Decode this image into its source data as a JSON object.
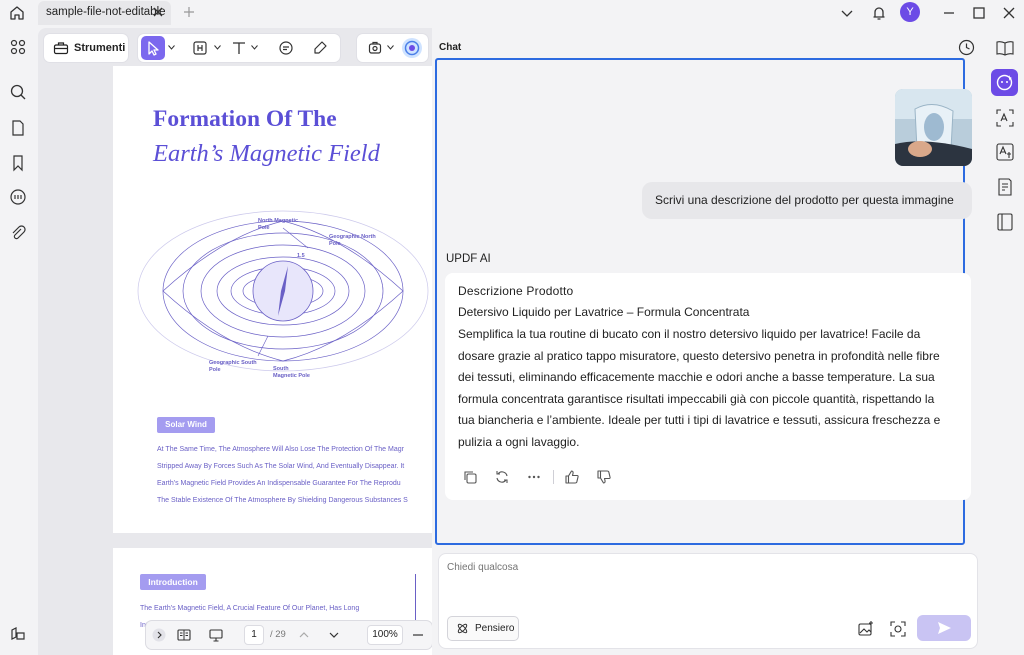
{
  "titlebar": {
    "tab_title": "sample-file-not-editable",
    "avatar_initial": "Y"
  },
  "toolbar": {
    "strumenti_label": "Strumenti"
  },
  "document": {
    "title_line1": "Formation Of The",
    "title_line2": "Earth’s Magnetic Field",
    "diagram_labels": {
      "north_magnetic_pole": "North Magnetic Pole",
      "geographic_north_pole": "Geographic North Pole",
      "angle": "1.5",
      "geographic_south_pole": "Geographic South Pole",
      "south_magnetic_pole": "South Magnetic Pole"
    },
    "solar_wind_tag": "Solar Wind",
    "body_lines": [
      "At The Same Time, The Atmosphere Will Also Lose The Protection Of The Magr",
      "Stripped Away By Forces Such As The Solar Wind, And Eventually Disappear. It",
      "Earth's Magnetic Field Provides An Indispensable Guarantee For The Reprodu",
      "The Stable Existence Of The Atmosphere By Shielding Dangerous Substances S"
    ],
    "intro_tag": "Introduction",
    "intro_lines": [
      "The Earth's Magnetic Field, A Crucial Feature Of Our Planet, Has Long",
      "Int"
    ]
  },
  "pager": {
    "current_page": "1",
    "total_pages": "/ 29",
    "zoom": "100%"
  },
  "chat": {
    "header": "Chat",
    "user_message": "Scrivi una descrizione del prodotto per questa immagine",
    "ai_name": "UPDF AI",
    "response_title": "Descrizione Prodotto",
    "response_subtitle": "Detersivo Liquido per Lavatrice – Formula Concentrata",
    "response_lines": [
      "Semplifica la tua routine di bucato con il nostro detersivo liquido per lavatrice! Facile da",
      "dosare grazie al pratico tappo misuratore, questo detersivo penetra in profondità nelle fibre",
      "dei tessuti, eliminando efficacemente macchie e odori anche a basse temperature. La sua",
      "formula concentrata garantisce risultati impeccabili già con piccole quantità, rispettando la",
      "tua biancheria e l’ambiente. Ideale per tutti i tipi di lavatrice e tessuti, assicura freschezza e",
      "pulizia a ogni lavaggio."
    ],
    "input_placeholder": "Chiedi qualcosa",
    "pensiero_label": "Pensiero"
  },
  "icons": {
    "titlebar": [
      "home-icon",
      "close-icon",
      "plus-icon",
      "chevron-down-icon",
      "bell-icon",
      "minimize-icon",
      "maximize-icon",
      "close-icon"
    ],
    "left_rail": [
      "grid-icon",
      "search-icon",
      "page-icon",
      "bookmark-icon",
      "comment-icon",
      "attachment-icon",
      "layers-icon"
    ],
    "right_rail": [
      "book-open-icon",
      "ai-assistant-icon",
      "ocr-icon",
      "translate-icon",
      "summarize-icon",
      "reader-icon"
    ],
    "response_actions": [
      "copy-icon",
      "regenerate-icon",
      "more-icon",
      "thumbs-up-icon",
      "thumbs-down-icon"
    ]
  },
  "colors": {
    "accent": "#6c4be6",
    "selection_border": "#2d6be0",
    "doc_purple": "#5b4fd6"
  }
}
